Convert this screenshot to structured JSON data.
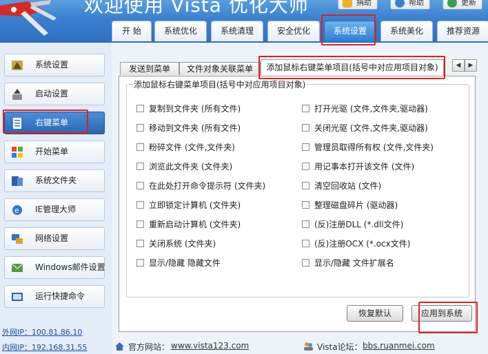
{
  "header": {
    "title": "欢迎使用 Vista 优化大师",
    "buttons": [
      {
        "label": "捐助",
        "icon": "donate-icon"
      },
      {
        "label": "帮助",
        "icon": "help-icon"
      },
      {
        "label": "更新",
        "icon": "update-icon"
      }
    ],
    "tabs": [
      {
        "label": "开 始"
      },
      {
        "label": "系统优化"
      },
      {
        "label": "系统清理"
      },
      {
        "label": "安全优化"
      },
      {
        "label": "系统设置",
        "active": true
      },
      {
        "label": "系统美化"
      },
      {
        "label": "推荐资源"
      }
    ]
  },
  "sidebar": {
    "items": [
      {
        "label": "系统设置",
        "icon": "system-settings-icon"
      },
      {
        "label": "启动设置",
        "icon": "startup-icon"
      },
      {
        "label": "右键菜单",
        "icon": "context-menu-icon",
        "active": true
      },
      {
        "label": "开始菜单",
        "icon": "windows-start-icon"
      },
      {
        "label": "系统文件夹",
        "icon": "folder-icon"
      },
      {
        "label": "IE管理大师",
        "icon": "ie-icon"
      },
      {
        "label": "网络设置",
        "icon": "network-icon"
      },
      {
        "label": "Windows邮件设置",
        "icon": "mail-icon"
      },
      {
        "label": "运行快捷命令",
        "icon": "run-icon"
      }
    ],
    "external_ip": "外网IP：100.81.86.10",
    "internal_ip": "内网IP：192.168.31.55"
  },
  "main": {
    "subtabs": [
      {
        "label": "发送到菜单"
      },
      {
        "label": "文件对象关联菜单"
      },
      {
        "label": "添加鼠标右键菜单项目(括号中对应用项目对象)",
        "active": true
      }
    ],
    "group_title": "添加鼠标右键菜单项目(括号中对应用项目对象)",
    "left_options": [
      "复制到文件夹 (所有文件)",
      "移动到文件夹 (所有文件)",
      "粉碎文件 (文件,文件夹)",
      "浏览此文件夹 (文件夹)",
      "在此处打开命令提示符 (文件夹)",
      "立即锁定计算机 (文件夹)",
      "重新启动计算机 (文件夹)",
      "关闭系统 (文件夹)",
      "显示/隐藏 隐藏文件"
    ],
    "right_options": [
      "打开光驱 (文件,文件夹,驱动器)",
      "关闭光驱 (文件,文件夹,驱动器)",
      "管理员取得所有权 (文件,文件夹)",
      "用记事本打开该文件 (文件)",
      "清空回收站 (文件)",
      "整理磁盘碎片 (驱动器)",
      "(反)注册DLL (*.dll文件)",
      "(反)注册OCX (*.ocx文件)",
      "显示/隐藏 文件扩展名"
    ],
    "restore_button": "恢复默认",
    "apply_button": "应用到系统"
  },
  "footer": {
    "site_label": "官方网站：",
    "site_url": "www.vista123.com",
    "forum_label": "Vista论坛：",
    "forum_url": "bbs.ruanmei.com"
  },
  "colors": {
    "header_blue": "#3a7fd0",
    "active_tab": "#2f7ed3",
    "highlight_red": "#e02020"
  }
}
